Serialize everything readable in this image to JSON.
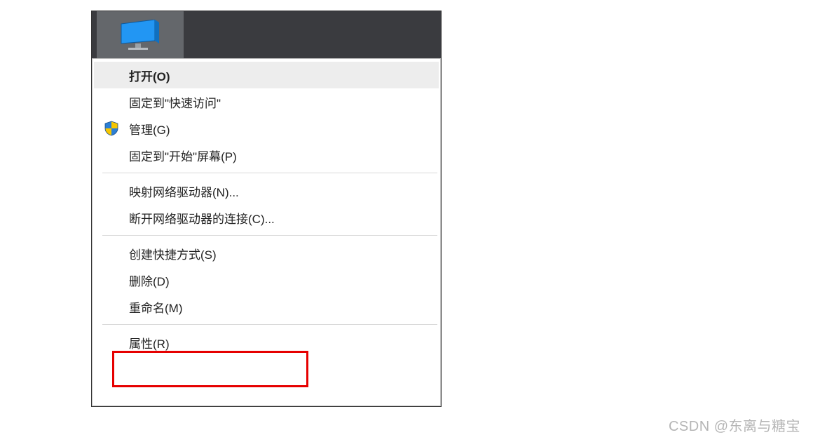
{
  "taskbar": {
    "icon_name": "this-pc"
  },
  "menu": {
    "groups": [
      [
        {
          "id": "open",
          "label": "打开(O)",
          "highlighted": true
        },
        {
          "id": "pin-quick",
          "label": "固定到\"快速访问\""
        },
        {
          "id": "manage",
          "label": "管理(G)",
          "icon": "shield"
        },
        {
          "id": "pin-start",
          "label": "固定到\"开始\"屏幕(P)"
        }
      ],
      [
        {
          "id": "map-drive",
          "label": "映射网络驱动器(N)..."
        },
        {
          "id": "disconnect",
          "label": "断开网络驱动器的连接(C)..."
        }
      ],
      [
        {
          "id": "shortcut",
          "label": "创建快捷方式(S)"
        },
        {
          "id": "delete",
          "label": "删除(D)"
        },
        {
          "id": "rename",
          "label": "重命名(M)"
        }
      ],
      [
        {
          "id": "properties",
          "label": "属性(R)",
          "callout": true
        }
      ]
    ]
  },
  "watermark": "CSDN @东离与糖宝",
  "colors": {
    "callout": "#e60000",
    "taskbar": "#3a3b3f",
    "highlight": "#ededed"
  }
}
